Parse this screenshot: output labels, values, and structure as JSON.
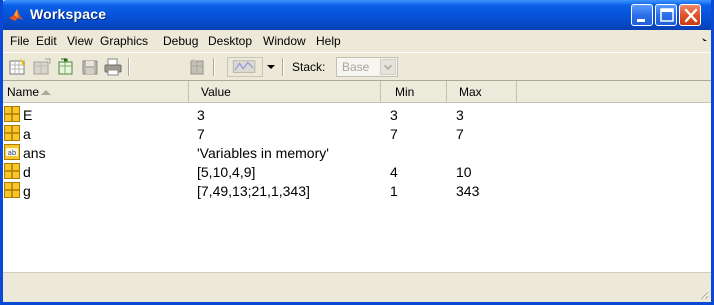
{
  "window": {
    "title": "Workspace"
  },
  "menu": [
    "File",
    "Edit",
    "View",
    "Graphics",
    "Debug",
    "Desktop",
    "Window",
    "Help"
  ],
  "toolbar": {
    "stack_label": "Stack:",
    "stack_value": "Base",
    "icons": [
      "new-variable-icon",
      "open-variable-icon",
      "import-data-icon",
      "save-icon",
      "print-icon",
      "delete-icon",
      "plot-icon"
    ]
  },
  "table": {
    "headers": {
      "name": "Name",
      "value": "Value",
      "min": "Min",
      "max": "Max"
    },
    "sort": "ascending-by-name",
    "rows": [
      {
        "name": "E",
        "value": "3",
        "min": "3",
        "max": "3",
        "icon": "matrix-icon"
      },
      {
        "name": "a",
        "value": "7",
        "min": "7",
        "max": "7",
        "icon": "matrix-icon"
      },
      {
        "name": "ans",
        "value": "'Variables in memory'",
        "min": "",
        "max": "",
        "icon": "char-array-icon"
      },
      {
        "name": "d",
        "value": "[5,10,4,9]",
        "min": "4",
        "max": "10",
        "icon": "matrix-icon"
      },
      {
        "name": "g",
        "value": "[7,49,13;21,1,343]",
        "min": "1",
        "max": "343",
        "icon": "matrix-icon"
      }
    ]
  },
  "colors": {
    "titlebar": "#0653d8",
    "chrome": "#ece9d8",
    "close": "#e0532a",
    "matrix_icon": "#e8a800"
  }
}
